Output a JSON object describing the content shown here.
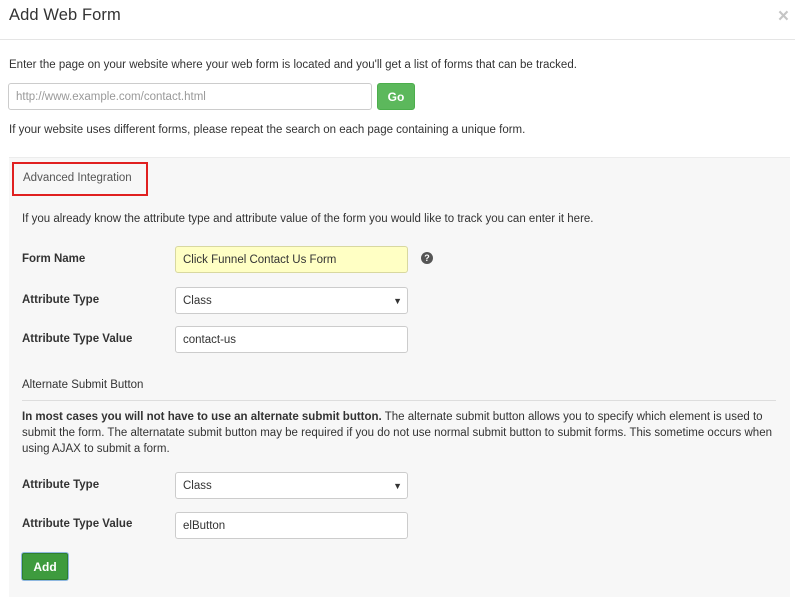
{
  "dialog": {
    "title": "Add Web Form",
    "close_icon": "close-icon",
    "close_glyph": "×"
  },
  "search": {
    "intro": "Enter the page on your website where your web form is located and you'll get a list of forms that can be tracked.",
    "placeholder": "http://www.example.com/contact.html",
    "value": "",
    "go_label": "Go",
    "repeat_note": "If your website uses different forms, please repeat the search on each page containing a unique form."
  },
  "advanced": {
    "heading": "Advanced Integration",
    "description": "If you already know the attribute type and attribute value of the form you would like to track you can enter it here.",
    "form_name_label": "Form Name",
    "form_name_value": "Click Funnel Contact Us Form",
    "help_icon": "question-circle-icon",
    "help_glyph": "?",
    "attr_type_label": "Attribute Type",
    "attr_type_value": "Class",
    "attr_value_label": "Attribute Type Value",
    "attr_value_value": "contact-us"
  },
  "alternate": {
    "heading": "Alternate Submit Button",
    "desc_bold": "In most cases you will not have to use an alternate submit button.",
    "desc_rest": " The alternate submit button allows you to specify which element is used to submit the form. The alternatate submit button may be required if you do not use normal submit button to submit forms. This sometime occurs when using AJAX to submit a form.",
    "attr_type_label": "Attribute Type",
    "attr_type_value": "Class",
    "attr_value_label": "Attribute Type Value",
    "attr_value_value": "elButton"
  },
  "footer": {
    "add_label": "Add"
  },
  "dropdown_arrow_glyph": "▼",
  "colors": {
    "go_button": "#5cb85c",
    "add_button": "#3e9b3e",
    "highlight_field": "#ffffc4",
    "annotation_box": "#e02020",
    "panel_bg": "#f7f7f7"
  }
}
